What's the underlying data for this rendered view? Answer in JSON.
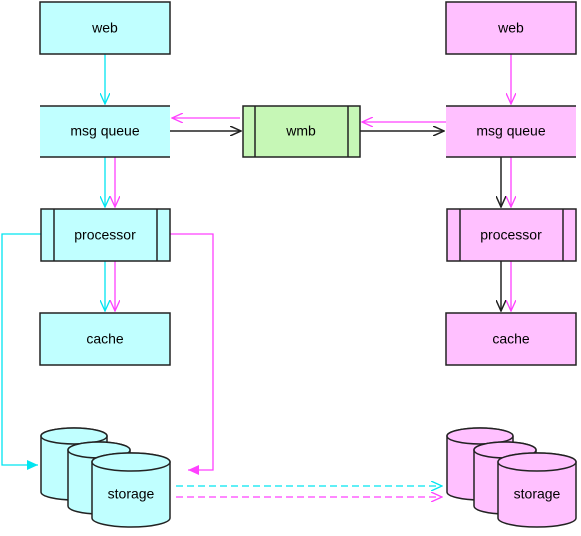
{
  "colors": {
    "left": "#c0ffff",
    "right": "#ffc0ff",
    "middle": "#c6f7b6",
    "cyan_line": "#00e5f0",
    "magenta_line": "#ff40ff",
    "black_line": "#222222"
  },
  "left": {
    "web": "web",
    "msg_queue": "msg queue",
    "processor": "processor",
    "cache": "cache",
    "storage": "storage"
  },
  "right": {
    "web": "web",
    "msg_queue": "msg queue",
    "processor": "processor",
    "cache": "cache",
    "storage": "storage"
  },
  "middle": {
    "wmb": "wmb"
  }
}
